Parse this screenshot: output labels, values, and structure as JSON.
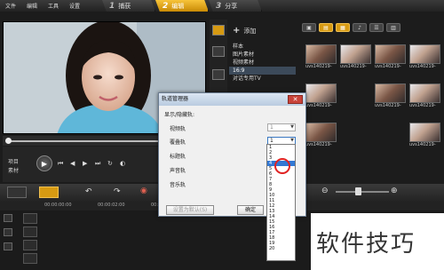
{
  "menu": [
    "文件",
    "编辑",
    "工具",
    "设置"
  ],
  "steps": [
    {
      "num": "1",
      "label": "捕获",
      "active": false
    },
    {
      "num": "2",
      "label": "编辑",
      "active": true
    },
    {
      "num": "3",
      "label": "分享",
      "active": false
    }
  ],
  "transport": {
    "project_label": "项目",
    "clip_label": "素材"
  },
  "library": {
    "add_label": "添加",
    "folders": [
      "样本",
      "图片素材",
      "视频素材",
      "16:9",
      "对话专用TV"
    ],
    "selected_folder": "16:9",
    "thumb_captions": [
      "uvs140219-",
      "uvs140219-",
      "uvs140219-",
      "uvs140219-",
      "uvs140219-",
      "uvs140219-",
      "uvs140219-",
      "uvs140219-",
      "uvs140219-"
    ]
  },
  "timeline": {
    "ruler": [
      "00:00:00:00",
      "00:00:02:00",
      "00:00:04:00"
    ]
  },
  "dialog": {
    "title": "轨道管理器",
    "section": "显示/隐藏轨:",
    "rows": [
      {
        "label": "视频轨",
        "value": "1"
      },
      {
        "label": "覆叠轨",
        "value": "1"
      },
      {
        "label": "标题轨",
        "value": ""
      },
      {
        "label": "声音轨",
        "value": ""
      },
      {
        "label": "音乐轨",
        "value": ""
      }
    ],
    "default_button": "设置为默认(S)",
    "ok_button": "确定"
  },
  "dropdown_options": [
    "1",
    "2",
    "3",
    "4",
    "5",
    "6",
    "7",
    "8",
    "9",
    "10",
    "11",
    "12",
    "13",
    "14",
    "15",
    "16",
    "17",
    "18",
    "19",
    "20"
  ],
  "dropdown_highlight": "4",
  "watermark": "软件技巧",
  "colors": {
    "accent": "#d79a12",
    "highlight": "#3278d4",
    "annotation": "#e02222"
  }
}
